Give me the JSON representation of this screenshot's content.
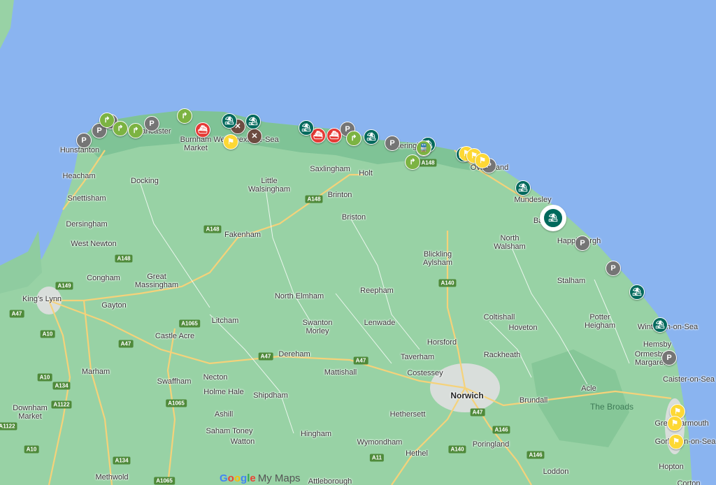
{
  "map": {
    "colors": {
      "sea": "#8ab4f0",
      "land": "#98d2a5",
      "coast_band": "#7fc396",
      "road": "#f5d27a",
      "minor_road": "#ffffff",
      "urban": "#d9dedb"
    },
    "places": [
      {
        "name": "Hunstanton",
        "type": "town"
      },
      {
        "name": "Heacham",
        "type": "town"
      },
      {
        "name": "Snettisham",
        "type": "town"
      },
      {
        "name": "Dersingham",
        "type": "town"
      },
      {
        "name": "West Newton",
        "type": "town"
      },
      {
        "name": "Docking",
        "type": "town"
      },
      {
        "name": "Brancaster",
        "type": "town"
      },
      {
        "name": "Burnham\nMarket",
        "type": "town"
      },
      {
        "name": "Wells-next-the-Sea",
        "type": "town"
      },
      {
        "name": "Little\nWalsingham",
        "type": "town"
      },
      {
        "name": "Saxlingham",
        "type": "town"
      },
      {
        "name": "Holt",
        "type": "town"
      },
      {
        "name": "Sheringham",
        "type": "town"
      },
      {
        "name": "Overstrand",
        "type": "town"
      },
      {
        "name": "Mundesley",
        "type": "town"
      },
      {
        "name": "Bacton",
        "type": "town"
      },
      {
        "name": "Happisburgh",
        "type": "town"
      },
      {
        "name": "North\nWalsham",
        "type": "town"
      },
      {
        "name": "Brinton",
        "type": "town"
      },
      {
        "name": "Briston",
        "type": "town"
      },
      {
        "name": "Fakenham",
        "type": "town"
      },
      {
        "name": "Congham",
        "type": "town"
      },
      {
        "name": "Great\nMassingham",
        "type": "town"
      },
      {
        "name": "King's Lynn",
        "type": "town"
      },
      {
        "name": "Gayton",
        "type": "town"
      },
      {
        "name": "Blickling\nAylsham",
        "type": "town"
      },
      {
        "name": "Stalham",
        "type": "town"
      },
      {
        "name": "Reepham",
        "type": "town"
      },
      {
        "name": "North Elmham",
        "type": "town"
      },
      {
        "name": "Litcham",
        "type": "town"
      },
      {
        "name": "Coltishall",
        "type": "town"
      },
      {
        "name": "Potter\nHeigham",
        "type": "town"
      },
      {
        "name": "Winterton-on-Sea",
        "type": "town"
      },
      {
        "name": "Hoveton",
        "type": "town"
      },
      {
        "name": "Castle Acre",
        "type": "town"
      },
      {
        "name": "Swanton\nMorley",
        "type": "town"
      },
      {
        "name": "Lenwade",
        "type": "town"
      },
      {
        "name": "Hemsby",
        "type": "town"
      },
      {
        "name": "Horsford",
        "type": "town"
      },
      {
        "name": "Ormesby\nMargaret",
        "type": "town"
      },
      {
        "name": "Dereham",
        "type": "town"
      },
      {
        "name": "Taverham",
        "type": "town"
      },
      {
        "name": "Rackheath",
        "type": "town"
      },
      {
        "name": "Marham",
        "type": "town"
      },
      {
        "name": "Swaffham",
        "type": "town"
      },
      {
        "name": "Mattishall",
        "type": "town"
      },
      {
        "name": "Costessey",
        "type": "town"
      },
      {
        "name": "Caister-on-Sea",
        "type": "town"
      },
      {
        "name": "Necton",
        "type": "town"
      },
      {
        "name": "Holme Hale",
        "type": "town"
      },
      {
        "name": "Shipdham",
        "type": "town"
      },
      {
        "name": "Norwich",
        "type": "major"
      },
      {
        "name": "Acle",
        "type": "town"
      },
      {
        "name": "Downham\nMarket",
        "type": "town"
      },
      {
        "name": "Brundall",
        "type": "town"
      },
      {
        "name": "The Broads",
        "type": "area"
      },
      {
        "name": "Ashill",
        "type": "town"
      },
      {
        "name": "Hethersett",
        "type": "town"
      },
      {
        "name": "Great Yarmouth",
        "type": "town"
      },
      {
        "name": "Saham Toney",
        "type": "town"
      },
      {
        "name": "Watton",
        "type": "town"
      },
      {
        "name": "Hingham",
        "type": "town"
      },
      {
        "name": "Wymondham",
        "type": "town"
      },
      {
        "name": "Poringland",
        "type": "town"
      },
      {
        "name": "Gorleston-on-Sea",
        "type": "town"
      },
      {
        "name": "Hethel",
        "type": "town"
      },
      {
        "name": "Hopton",
        "type": "town"
      },
      {
        "name": "Methwold",
        "type": "town"
      },
      {
        "name": "Loddon",
        "type": "town"
      },
      {
        "name": "Attleborough",
        "type": "town"
      },
      {
        "name": "Corton",
        "type": "town"
      }
    ],
    "roads": [
      "A148",
      "A148",
      "A148",
      "A148",
      "A149",
      "A47",
      "A10",
      "A10",
      "A134",
      "A1122",
      "A1122",
      "A10",
      "A47",
      "A1065",
      "A1065",
      "A134",
      "A1065",
      "A47",
      "A47",
      "A140",
      "A140",
      "A146",
      "A146",
      "A11",
      "A47"
    ],
    "markers": [
      {
        "type": "parking",
        "color": "#757575",
        "glyph": "P"
      },
      {
        "type": "parking",
        "color": "#757575",
        "glyph": "P"
      },
      {
        "type": "parking",
        "color": "#757575",
        "glyph": "P"
      },
      {
        "type": "parking",
        "color": "#757575",
        "glyph": "P"
      },
      {
        "type": "parking",
        "color": "#757575",
        "glyph": "P"
      },
      {
        "type": "parking",
        "color": "#757575",
        "glyph": "P"
      },
      {
        "type": "parking",
        "color": "#757575",
        "glyph": "P"
      },
      {
        "type": "parking",
        "color": "#757575",
        "glyph": "P"
      },
      {
        "type": "parking",
        "color": "#757575",
        "glyph": "P"
      },
      {
        "type": "parking",
        "color": "#757575",
        "glyph": "P"
      },
      {
        "type": "nature",
        "color": "#7cb342",
        "glyph": "↱"
      },
      {
        "type": "nature",
        "color": "#7cb342",
        "glyph": "↱"
      },
      {
        "type": "nature",
        "color": "#7cb342",
        "glyph": "↱"
      },
      {
        "type": "nature",
        "color": "#7cb342",
        "glyph": "↱"
      },
      {
        "type": "nature",
        "color": "#7cb342",
        "glyph": "↱"
      },
      {
        "type": "nature",
        "color": "#7cb342",
        "glyph": "↱"
      },
      {
        "type": "nature",
        "color": "#7cb342",
        "glyph": "↱"
      },
      {
        "type": "ferry",
        "color": "#e53935",
        "glyph": "⛴"
      },
      {
        "type": "ferry",
        "color": "#e53935",
        "glyph": "⛴"
      },
      {
        "type": "ferry",
        "color": "#e53935",
        "glyph": "⛴"
      },
      {
        "type": "restaurant",
        "color": "#6d4c41",
        "glyph": "✕"
      },
      {
        "type": "restaurant",
        "color": "#6d4c41",
        "glyph": "✕"
      },
      {
        "type": "beach",
        "color": "#00695c",
        "glyph": "⛱"
      },
      {
        "type": "beach",
        "color": "#00695c",
        "glyph": "⛱"
      },
      {
        "type": "beach",
        "color": "#00695c",
        "glyph": "⛱"
      },
      {
        "type": "beach",
        "color": "#00695c",
        "glyph": "⛱"
      },
      {
        "type": "beach",
        "color": "#00695c",
        "glyph": "⛱"
      },
      {
        "type": "beach",
        "color": "#00695c",
        "glyph": "⛱"
      },
      {
        "type": "beach",
        "color": "#00695c",
        "glyph": "⛱"
      },
      {
        "type": "beach",
        "color": "#00695c",
        "glyph": "⛱"
      },
      {
        "type": "beach",
        "color": "#00695c",
        "glyph": "⛱"
      },
      {
        "type": "beach",
        "color": "#00695c",
        "glyph": "⛱",
        "selected": true
      },
      {
        "type": "attraction",
        "color": "#fdd835",
        "glyph": "⚑"
      },
      {
        "type": "attraction",
        "color": "#fdd835",
        "glyph": "⚑"
      },
      {
        "type": "attraction",
        "color": "#fdd835",
        "glyph": "⚑"
      },
      {
        "type": "attraction",
        "color": "#fdd835",
        "glyph": "⚑"
      },
      {
        "type": "attraction",
        "color": "#fdd835",
        "glyph": "⚑"
      },
      {
        "type": "attraction",
        "color": "#fdd835",
        "glyph": "⚑"
      },
      {
        "type": "attraction",
        "color": "#fdd835",
        "glyph": "⚑"
      },
      {
        "type": "train",
        "color": "#7cb342",
        "glyph": "🚆"
      }
    ],
    "logo": {
      "google": "Google",
      "product": "My Maps"
    }
  }
}
